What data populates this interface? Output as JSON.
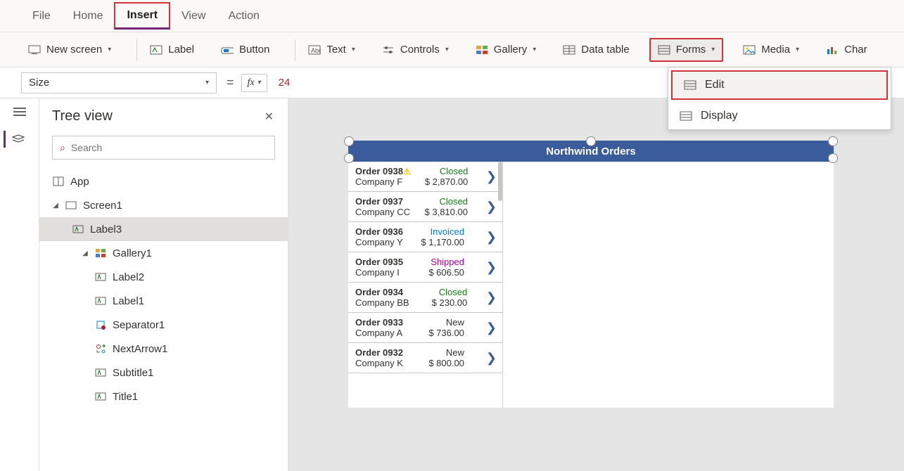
{
  "menubar": {
    "items": [
      "File",
      "Home",
      "Insert",
      "View",
      "Action"
    ],
    "active": "Insert"
  },
  "ribbon": {
    "new_screen": "New screen",
    "label": "Label",
    "button": "Button",
    "text": "Text",
    "controls": "Controls",
    "gallery": "Gallery",
    "data_table": "Data table",
    "forms": "Forms",
    "media": "Media",
    "chart": "Char"
  },
  "forms_dropdown": {
    "edit": "Edit",
    "display": "Display"
  },
  "formula_bar": {
    "property": "Size",
    "value": "24",
    "fx": "fx"
  },
  "tree": {
    "title": "Tree view",
    "search_placeholder": "Search",
    "app": "App",
    "screen1": "Screen1",
    "label3": "Label3",
    "gallery1": "Gallery1",
    "label2": "Label2",
    "label1": "Label1",
    "separator1": "Separator1",
    "nextarrow1": "NextArrow1",
    "subtitle1": "Subtitle1",
    "title1": "Title1"
  },
  "canvas": {
    "app_title": "Northwind Orders",
    "orders": [
      {
        "title": "Order 0938",
        "warn": true,
        "company": "Company F",
        "status": "Closed",
        "amount": "$ 2,870.00"
      },
      {
        "title": "Order 0937",
        "warn": false,
        "company": "Company CC",
        "status": "Closed",
        "amount": "$ 3,810.00"
      },
      {
        "title": "Order 0936",
        "warn": false,
        "company": "Company Y",
        "status": "Invoiced",
        "amount": "$ 1,170.00"
      },
      {
        "title": "Order 0935",
        "warn": false,
        "company": "Company I",
        "status": "Shipped",
        "amount": "$ 606.50"
      },
      {
        "title": "Order 0934",
        "warn": false,
        "company": "Company BB",
        "status": "Closed",
        "amount": "$ 230.00"
      },
      {
        "title": "Order 0933",
        "warn": false,
        "company": "Company A",
        "status": "New",
        "amount": "$ 736.00"
      },
      {
        "title": "Order 0932",
        "warn": false,
        "company": "Company K",
        "status": "New",
        "amount": "$ 800.00"
      }
    ]
  }
}
